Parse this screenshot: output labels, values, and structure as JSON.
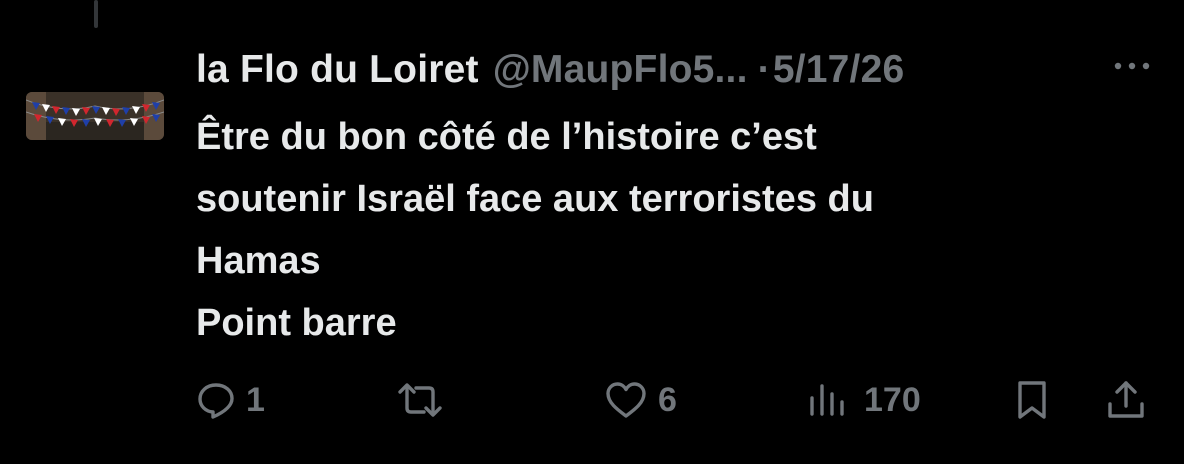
{
  "tweet": {
    "author_name": "la Flo du Loiret",
    "handle": "@MaupFlo5...",
    "separator": "·",
    "date": "5/17/26",
    "text_lines": [
      "Être du bon côté de l’histoire c’est",
      "soutenir Israël face aux terroristes du",
      "Hamas",
      "Point barre"
    ]
  },
  "actions": {
    "reply_count": "1",
    "like_count": "6",
    "views_count": "170"
  },
  "icons": {
    "more": "more-horizontal-icon",
    "reply": "reply-icon",
    "retweet": "retweet-icon",
    "like": "heart-icon",
    "views": "views-bar-chart-icon",
    "bookmark": "bookmark-icon",
    "share": "share-icon"
  },
  "colors": {
    "background": "#000000",
    "primary_text": "#e7e9ea",
    "secondary_text": "#71767b",
    "thread_line": "#333639"
  }
}
